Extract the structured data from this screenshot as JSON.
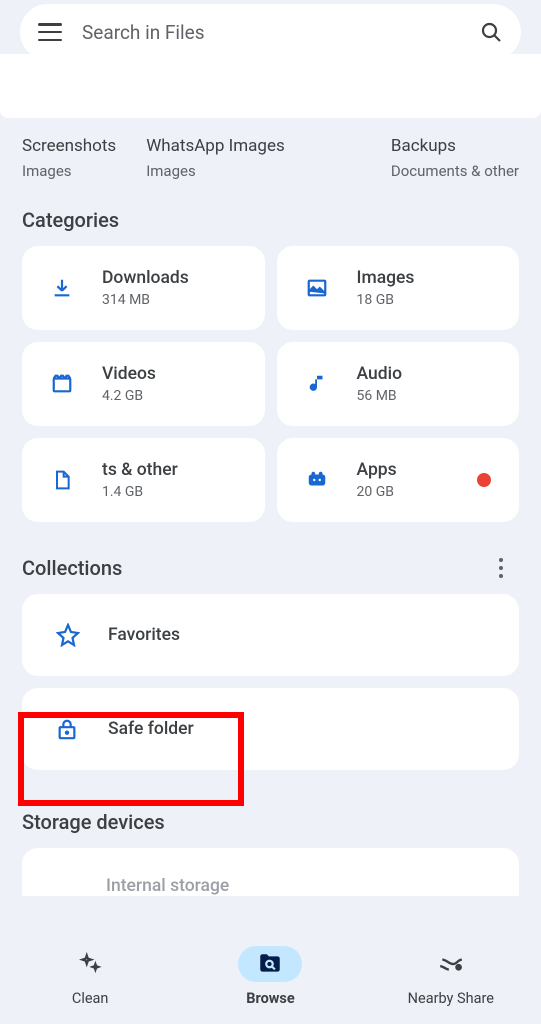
{
  "search": {
    "placeholder": "Search in Files"
  },
  "recent": [
    {
      "title": "Screenshots",
      "sub": "Images"
    },
    {
      "title": "WhatsApp Images",
      "sub": "Images"
    },
    {
      "title": "Backups",
      "sub": "Documents & other"
    }
  ],
  "sections": {
    "categories": "Categories",
    "collections": "Collections",
    "storage": "Storage devices"
  },
  "categories": [
    {
      "label": "Downloads",
      "size": "314 MB"
    },
    {
      "label": "Images",
      "size": "18 GB"
    },
    {
      "label": "Videos",
      "size": "4.2 GB"
    },
    {
      "label": "Audio",
      "size": "56 MB"
    },
    {
      "label": "ts & other",
      "size": "1.4 GB"
    },
    {
      "label": "Apps",
      "size": "20 GB",
      "dot": true
    }
  ],
  "collections": {
    "favorites": "Favorites",
    "safefolder": "Safe folder"
  },
  "storage": {
    "internal": "Internal storage"
  },
  "nav": {
    "clean": "Clean",
    "browse": "Browse",
    "share": "Nearby Share"
  },
  "colors": {
    "accent": "#1a73e8",
    "icon": "#1967d2"
  }
}
